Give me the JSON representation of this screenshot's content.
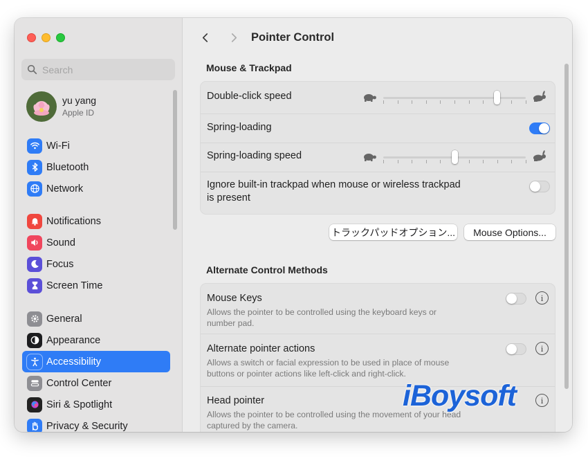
{
  "window": {
    "title": "Pointer Control"
  },
  "search": {
    "placeholder": "Search"
  },
  "profile": {
    "name": "yu yang",
    "subtitle": "Apple ID"
  },
  "sidebar": {
    "group1": [
      {
        "label": "Wi-Fi",
        "icon": "wifi-icon",
        "color": "#2f7cf6"
      },
      {
        "label": "Bluetooth",
        "icon": "bluetooth-icon",
        "color": "#2f7cf6"
      },
      {
        "label": "Network",
        "icon": "globe-icon",
        "color": "#2f7cf6"
      }
    ],
    "group2": [
      {
        "label": "Notifications",
        "icon": "bell-icon",
        "color": "#f0473f"
      },
      {
        "label": "Sound",
        "icon": "speaker-icon",
        "color": "#f0465d"
      },
      {
        "label": "Focus",
        "icon": "moon-icon",
        "color": "#5b4fd8"
      },
      {
        "label": "Screen Time",
        "icon": "hourglass-icon",
        "color": "#5b4fd8"
      }
    ],
    "group3": [
      {
        "label": "General",
        "icon": "gear-icon",
        "color": "#8e8e93"
      },
      {
        "label": "Appearance",
        "icon": "appearance-icon",
        "color": "#1d1d1f"
      },
      {
        "label": "Accessibility",
        "icon": "accessibility-icon",
        "color": "#2f7cf6",
        "active": true
      },
      {
        "label": "Control Center",
        "icon": "control-center-icon",
        "color": "#8e8e93"
      },
      {
        "label": "Siri & Spotlight",
        "icon": "siri-icon",
        "color": "#222222"
      },
      {
        "label": "Privacy & Security",
        "icon": "hand-icon",
        "color": "#2f7cf6"
      }
    ]
  },
  "sections": {
    "mouse_trackpad": {
      "title": "Mouse & Trackpad",
      "double_click_speed": {
        "label": "Double-click speed",
        "value": 0.8
      },
      "spring_loading": {
        "label": "Spring-loading",
        "enabled": true
      },
      "spring_loading_speed": {
        "label": "Spring-loading speed",
        "value": 0.5
      },
      "ignore_trackpad": {
        "label_line1": "Ignore built-in trackpad when mouse or wireless trackpad",
        "label_line2": "is present",
        "enabled": false
      }
    },
    "buttons": {
      "trackpad_options": "トラックパッドオプション...",
      "mouse_options": "Mouse Options..."
    },
    "alternate": {
      "title": "Alternate Control Methods",
      "mouse_keys": {
        "label": "Mouse Keys",
        "desc_line1": "Allows the pointer to be controlled using the keyboard keys or",
        "desc_line2": "number pad.",
        "enabled": false
      },
      "alt_pointer": {
        "label": "Alternate pointer actions",
        "desc_line1": "Allows a switch or facial expression to be used in place of mouse",
        "desc_line2": "buttons or pointer actions like left-click and right-click.",
        "enabled": false
      },
      "head_pointer": {
        "label": "Head pointer",
        "desc_line1": "Allows the pointer to be controlled using the movement of your head",
        "desc_line2": "captured by the camera."
      }
    }
  },
  "watermark": "iBoysoft"
}
